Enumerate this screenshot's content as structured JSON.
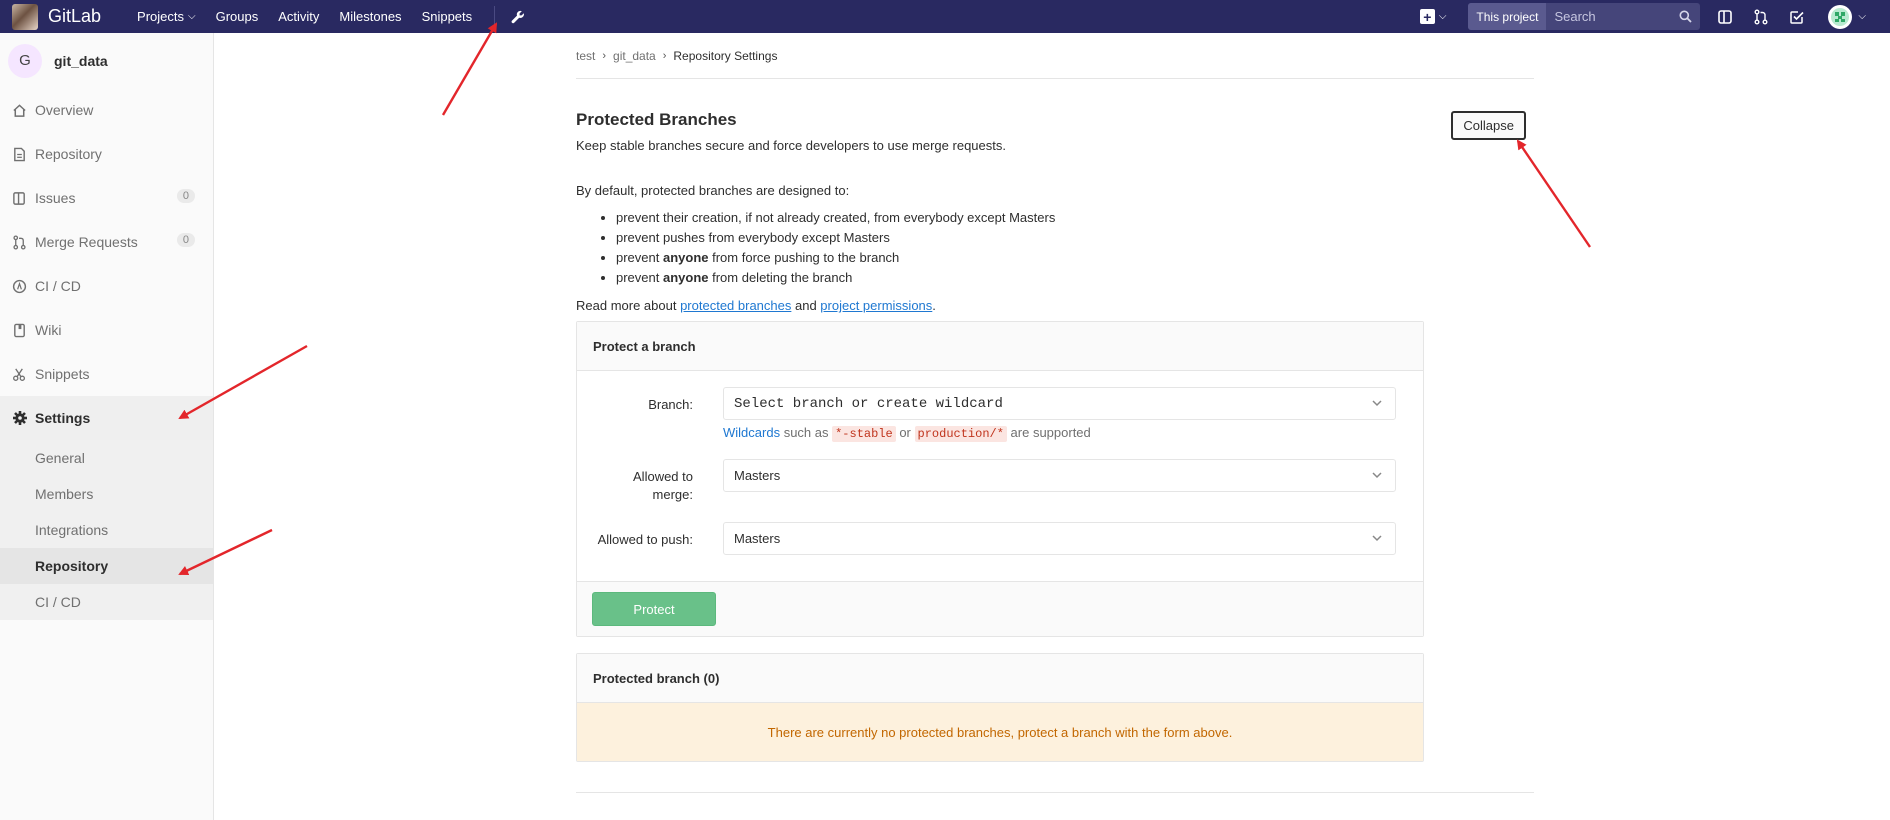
{
  "topbar": {
    "brand": "GitLab",
    "nav": [
      {
        "label": "Projects",
        "dropdown": true
      },
      {
        "label": "Groups"
      },
      {
        "label": "Activity"
      },
      {
        "label": "Milestones"
      },
      {
        "label": "Snippets"
      }
    ],
    "search_scope": "This project",
    "search_placeholder": "Search"
  },
  "sidebar": {
    "project_initial": "G",
    "project_name": "git_data",
    "items": [
      {
        "label": "Overview",
        "icon": "home-icon"
      },
      {
        "label": "Repository",
        "icon": "doc-icon"
      },
      {
        "label": "Issues",
        "icon": "issues-icon",
        "count": "0"
      },
      {
        "label": "Merge Requests",
        "icon": "merge-icon",
        "count": "0"
      },
      {
        "label": "CI / CD",
        "icon": "rocket-icon"
      },
      {
        "label": "Wiki",
        "icon": "book-icon"
      },
      {
        "label": "Snippets",
        "icon": "scissors-icon"
      },
      {
        "label": "Settings",
        "icon": "gear-icon"
      }
    ],
    "settings_sub": [
      {
        "label": "General"
      },
      {
        "label": "Members"
      },
      {
        "label": "Integrations"
      },
      {
        "label": "Repository"
      },
      {
        "label": "CI / CD"
      }
    ]
  },
  "breadcrumb": {
    "items": [
      "test",
      "git_data",
      "Repository Settings"
    ]
  },
  "section": {
    "title": "Protected Branches",
    "desc": "Keep stable branches secure and force developers to use merge requests.",
    "collapse_label": "Collapse",
    "intro": "By default, protected branches are designed to:",
    "bullets": {
      "b1": "prevent their creation, if not already created, from everybody except Masters",
      "b2": "prevent pushes from everybody except Masters",
      "b3_pre": "prevent ",
      "b3_bold": "anyone",
      "b3_post": " from force pushing to the branch",
      "b4_pre": "prevent ",
      "b4_bold": "anyone",
      "b4_post": " from deleting the branch"
    },
    "readmore_pre": "Read more about ",
    "readmore_link1": "protected branches",
    "readmore_mid": " and ",
    "readmore_link2": "project permissions",
    "readmore_post": "."
  },
  "protect_form": {
    "heading": "Protect a branch",
    "branch_label": "Branch:",
    "branch_placeholder": "Select branch or create wildcard",
    "help_link": "Wildcards",
    "help_mid1": " such as ",
    "help_code1": "*-stable",
    "help_mid2": " or ",
    "help_code2": "production/*",
    "help_post": " are supported",
    "merge_label": "Allowed to merge:",
    "merge_value": "Masters",
    "push_label": "Allowed to push:",
    "push_value": "Masters",
    "protect_button": "Protect"
  },
  "protected_list": {
    "heading": "Protected branch (0)",
    "empty_message": "There are currently no protected branches, protect a branch with the form above."
  },
  "colors": {
    "topbar": "#292961",
    "protect_button": "#69c189",
    "link": "#1f78d1",
    "annotation_arrow": "#e3262b",
    "empty_warning_bg": "#fdf1dd"
  }
}
